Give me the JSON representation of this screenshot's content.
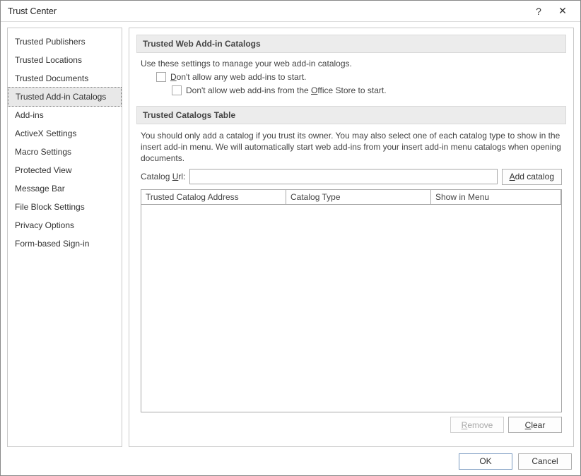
{
  "titlebar": {
    "title": "Trust Center",
    "help": "?",
    "close": "✕"
  },
  "sidebar": {
    "items": [
      {
        "label": "Trusted Publishers"
      },
      {
        "label": "Trusted Locations"
      },
      {
        "label": "Trusted Documents"
      },
      {
        "label": "Trusted Add-in Catalogs",
        "selected": true
      },
      {
        "label": "Add-ins"
      },
      {
        "label": "ActiveX Settings"
      },
      {
        "label": "Macro Settings"
      },
      {
        "label": "Protected View"
      },
      {
        "label": "Message Bar"
      },
      {
        "label": "File Block Settings"
      },
      {
        "label": "Privacy Options"
      },
      {
        "label": "Form-based Sign-in"
      }
    ]
  },
  "section1": {
    "header": "Trusted Web Add-in Catalogs",
    "intro": "Use these settings to manage your web add-in catalogs.",
    "cb1_pre": "D",
    "cb1_rest": "on't allow any web add-ins to start.",
    "cb2_pre": "Don't allow web add-ins from the ",
    "cb2_und": "O",
    "cb2_rest": "ffice Store to start."
  },
  "section2": {
    "header": "Trusted Catalogs Table",
    "intro": "You should only add a catalog if you trust its owner. You may also select one of each catalog type to show in the insert add-in menu. We will automatically start web add-ins from your insert add-in menu catalogs when opening documents.",
    "url_label_pre": "Catalog ",
    "url_label_und": "U",
    "url_label_post": "rl:",
    "add_btn_und": "A",
    "add_btn_rest": "dd catalog",
    "columns": {
      "c1": "Trusted Catalog Address",
      "c2": "Catalog Type",
      "c3": "Show in Menu"
    },
    "remove_und": "R",
    "remove_rest": "emove",
    "clear_und": "C",
    "clear_rest": "lear"
  },
  "footer": {
    "ok": "OK",
    "cancel": "Cancel"
  }
}
